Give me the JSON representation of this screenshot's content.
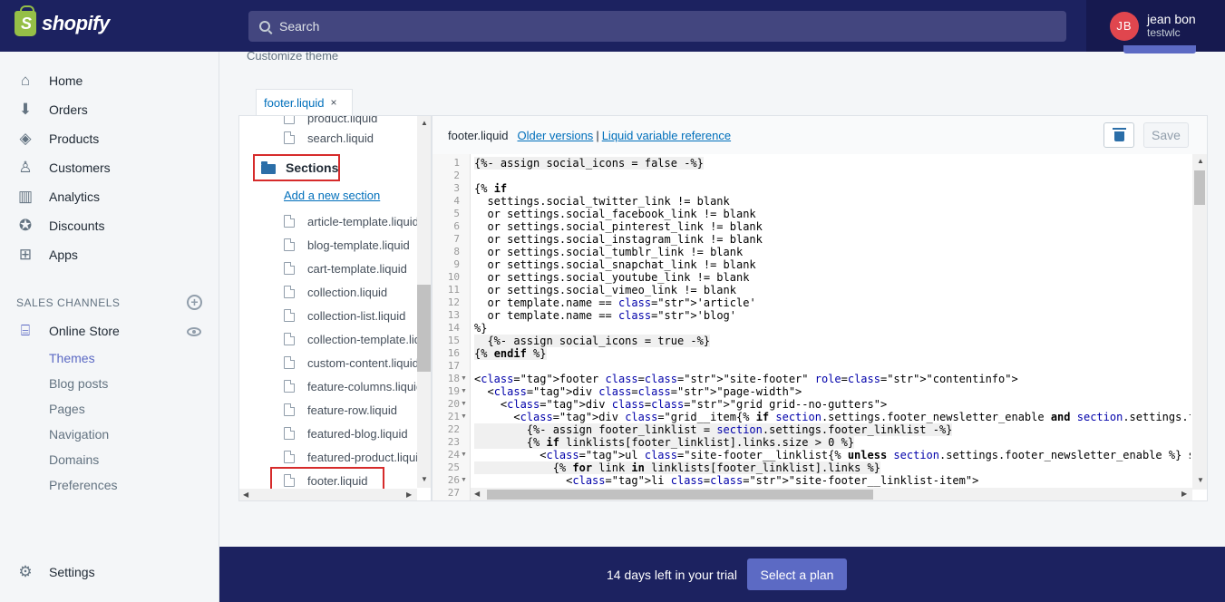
{
  "brand": {
    "name": "shopify",
    "logo_letter": "S"
  },
  "search": {
    "placeholder": "Search"
  },
  "user": {
    "initials": "JB",
    "name": "jean bon",
    "store": "testwlc"
  },
  "sidebar": {
    "items": [
      {
        "label": "Home",
        "icon": "home-icon",
        "glyph": "⌂"
      },
      {
        "label": "Orders",
        "icon": "orders-icon",
        "glyph": "⬇"
      },
      {
        "label": "Products",
        "icon": "tag-icon",
        "glyph": "◈"
      },
      {
        "label": "Customers",
        "icon": "person-icon",
        "glyph": "♙"
      },
      {
        "label": "Analytics",
        "icon": "bar-chart-icon",
        "glyph": "▥"
      },
      {
        "label": "Discounts",
        "icon": "discount-icon",
        "glyph": "✪"
      },
      {
        "label": "Apps",
        "icon": "apps-icon",
        "glyph": "⊞"
      }
    ],
    "channels_header": "SALES CHANNELS",
    "add_channel_glyph": "+",
    "online_store": {
      "label": "Online Store",
      "glyph": "⌸"
    },
    "store_subitems": [
      "Themes",
      "Blog posts",
      "Pages",
      "Navigation",
      "Domains",
      "Preferences"
    ],
    "active_subitem": "Themes",
    "settings": {
      "label": "Settings",
      "glyph": "⚙"
    }
  },
  "main": {
    "customize_label": "Customize theme",
    "tab": {
      "label": "footer.liquid",
      "close": "×"
    },
    "tree": {
      "top_files": [
        "product.liquid",
        "search.liquid"
      ],
      "folder": "Sections",
      "add_link": "Add a new section",
      "section_files": [
        "article-template.liquid",
        "blog-template.liquid",
        "cart-template.liquid",
        "collection.liquid",
        "collection-list.liquid",
        "collection-template.liquid",
        "custom-content.liquid",
        "feature-columns.liquid",
        "feature-row.liquid",
        "featured-blog.liquid",
        "featured-product.liquid",
        "footer.liquid"
      ]
    },
    "editor": {
      "filename": "footer.liquid",
      "older_versions": "Older versions",
      "separator": "|",
      "reference": "Liquid variable reference",
      "save_label": "Save",
      "line_numbers": [
        "1",
        "2",
        "3",
        "4",
        "5",
        "6",
        "7",
        "8",
        "9",
        "10",
        "11",
        "12",
        "13",
        "14",
        "15",
        "16",
        "17",
        "18",
        "19",
        "20",
        "21",
        "22",
        "23",
        "24",
        "25",
        "26",
        "27"
      ],
      "fold_lines": [
        "18",
        "19",
        "20",
        "21",
        "24",
        "26"
      ],
      "fold_glyph": "▼",
      "code_lines": [
        "{%- assign social_icons = false -%}",
        "",
        "{% if",
        "  settings.social_twitter_link != blank",
        "  or settings.social_facebook_link != blank",
        "  or settings.social_pinterest_link != blank",
        "  or settings.social_instagram_link != blank",
        "  or settings.social_tumblr_link != blank",
        "  or settings.social_snapchat_link != blank",
        "  or settings.social_youtube_link != blank",
        "  or settings.social_vimeo_link != blank",
        "  or template.name == 'article'",
        "  or template.name == 'blog'",
        "%}",
        "  {%- assign social_icons = true -%}",
        "{% endif %}",
        "",
        "<footer class=\"site-footer\" role=\"contentinfo\">",
        "  <div class=\"page-width\">",
        "    <div class=\"grid grid--no-gutters\">",
        "      <div class=\"grid__item{% if section.settings.footer_newsletter_enable and section.settings.footer",
        "        {%- assign footer_linklist = section.settings.footer_linklist -%}",
        "        {% if linklists[footer_linklist].links.size > 0 %}",
        "          <ul class=\"site-footer__linklist{% unless section.settings.footer_newsletter_enable %} site-f",
        "            {% for link in linklists[footer_linklist].links %}",
        "              <li class=\"site-footer__linklist-item\">",
        ""
      ]
    }
  },
  "trial": {
    "text": "14 days left in your trial",
    "button": "Select a plan"
  },
  "colors": {
    "nav_bg": "#1c2260",
    "accent": "#5c6ac4",
    "link": "#006fbb",
    "highlight": "#d62b2b"
  }
}
